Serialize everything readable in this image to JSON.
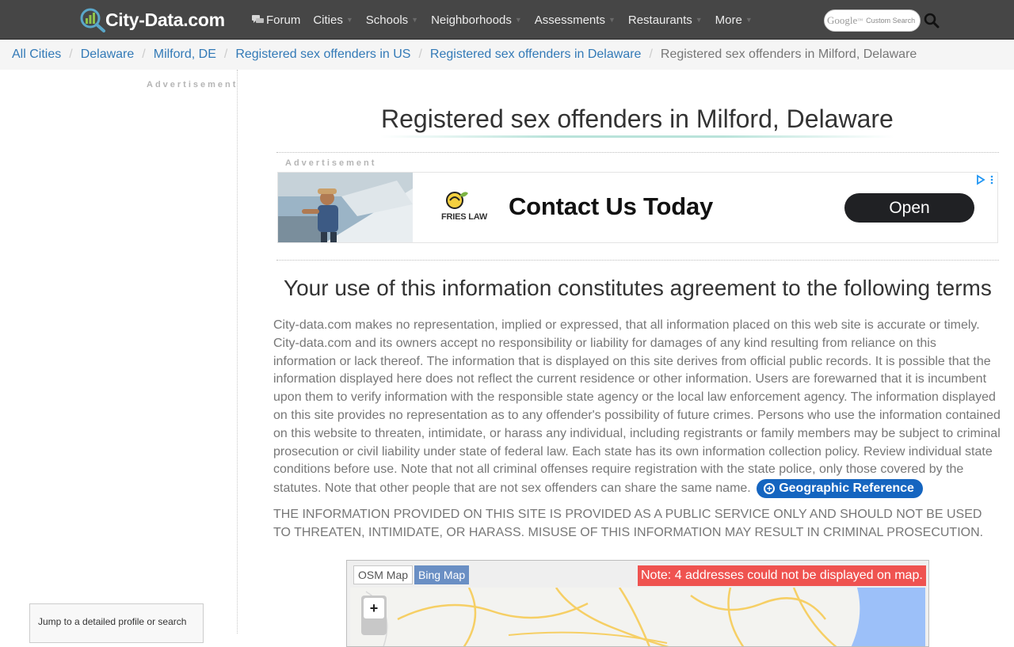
{
  "header": {
    "logo_text": "City-Data.com",
    "nav": [
      {
        "label": "Forum",
        "icon": "chat-bubbles-icon",
        "caret": false
      },
      {
        "label": "Cities",
        "caret": true
      },
      {
        "label": "Schools",
        "caret": true
      },
      {
        "label": "Neighborhoods",
        "caret": true
      },
      {
        "label": "Assessments",
        "caret": true
      },
      {
        "label": "Restaurants",
        "caret": true
      },
      {
        "label": "More",
        "caret": true
      }
    ],
    "search": {
      "brand": "Google",
      "tm": "™",
      "label": "Custom Search",
      "button_icon": "search-icon"
    }
  },
  "breadcrumb": {
    "links": [
      "All Cities",
      "Delaware",
      "Milford, DE",
      "Registered sex offenders in US",
      "Registered sex offenders in Delaware"
    ],
    "current": "Registered sex offenders in Milford, Delaware",
    "separator": "/"
  },
  "sidebar": {
    "ad_label": "Advertisement",
    "jump_text": "Jump to a detailed profile or search"
  },
  "main": {
    "title": "Registered sex offenders in Milford, Delaware",
    "ad": {
      "label": "Advertisement",
      "brand": "FRIES LAW",
      "headline": "Contact Us Today",
      "cta": "Open"
    },
    "terms_title": "Your use of this information constitutes agreement to the following terms",
    "terms_body": "City-data.com makes no representation, implied or expressed, that all information placed on this web site is accurate or timely. City-data.com and its owners accept no responsibility or liability for damages of any kind resulting from reliance on this information or lack thereof. The information that is displayed on this site derives from official public records. It is possible that the information displayed here does not reflect the current residence or other information. Users are forewarned that it is incumbent upon them to verify information with the responsible state agency or the local law enforcement agency. The information displayed on this site provides no representation as to any offender's possibility of future crimes. Persons who use the information contained on this website to threaten, intimidate, or harass any individual, including registrants or family members may be subject to criminal prosecution or civil liability under state of federal law. Each state has its own information collection policy. Review individual state conditions before use. Note that not all criminal offenses require registration with the state police, only those covered by the statutes. Note that other people that are not sex offenders can share the same name.",
    "geo_button": "Geographic Reference",
    "warning": "THE INFORMATION PROVIDED ON THIS SITE IS PROVIDED AS A PUBLIC SERVICE ONLY AND SHOULD NOT BE USED TO THREATEN, INTIMIDATE, OR HARASS. MISUSE OF THIS INFORMATION MAY RESULT IN CRIMINAL PROSECUTION.",
    "map": {
      "tabs": [
        "OSM Map",
        "Bing Map"
      ],
      "note": "Note: 4 addresses could not be displayed on map.",
      "zoom_in": "+"
    }
  },
  "colors": {
    "topbar": "#464646",
    "link": "#337ab7",
    "geo_button": "#1565c0",
    "map_note": "#ef5350",
    "bing_tab": "#6a8fc4"
  }
}
